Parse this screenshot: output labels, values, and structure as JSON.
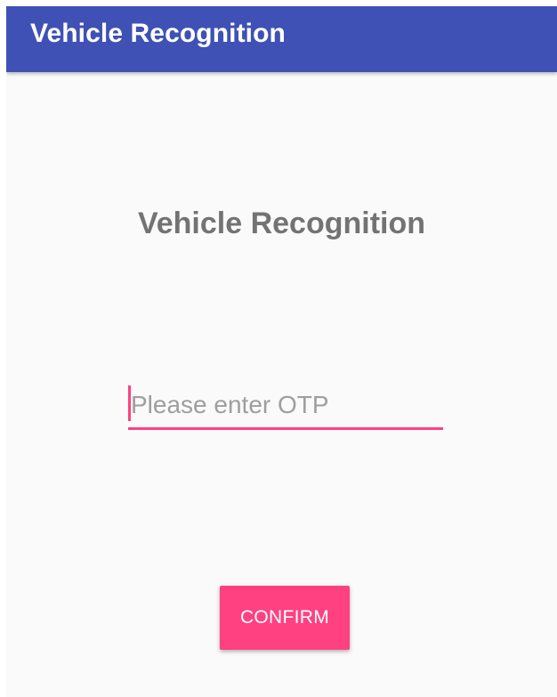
{
  "app_bar": {
    "title": "Vehicle Recognition"
  },
  "main": {
    "heading": "Vehicle Recognition",
    "otp_input": {
      "value": "",
      "placeholder": "Please enter OTP"
    },
    "confirm_button_label": "CONFIRM"
  },
  "colors": {
    "primary": "#3f51b5",
    "accent": "#ff4081",
    "background": "#fafafa",
    "heading_text": "#737373"
  }
}
